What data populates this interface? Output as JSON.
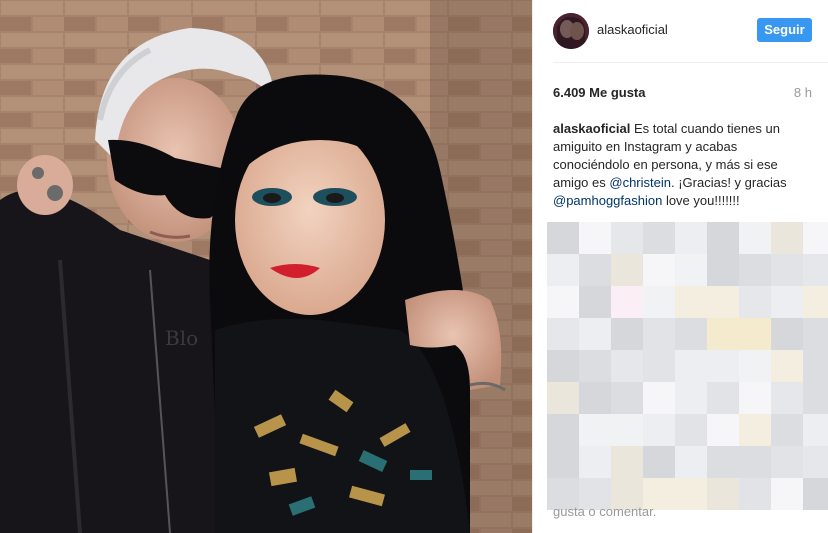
{
  "post": {
    "photo_alt": "Foto"
  },
  "header": {
    "username": "alaskaoficial",
    "follow_label": "Seguir"
  },
  "stats": {
    "likes": "6.409 Me gusta",
    "time": "8 h"
  },
  "caption": {
    "author": "alaskaoficial",
    "text_1": " Es total cuando tienes un amiguito en Instagram y acabas conociéndolo en persona, y más si ese amigo es ",
    "mention_1": "@christein",
    "text_2": ". ¡Gracias! y gracias ",
    "mention_2": "@pamhoggfashion",
    "text_3": " love you!!!!!!!"
  },
  "footer": {
    "comment_hint": "gusta o comentar."
  },
  "colors": {
    "accent": "#3897f0",
    "mention": "#003569",
    "muted": "#999999"
  },
  "icons": [
    "avatar-image"
  ]
}
